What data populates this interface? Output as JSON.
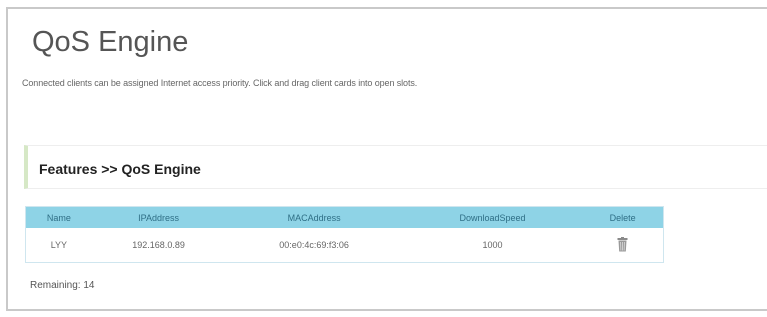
{
  "page": {
    "title": "QoS Engine",
    "description": "Connected clients can be assigned Internet access priority. Click and drag client cards into open slots."
  },
  "section": {
    "title": "Features >> QoS Engine"
  },
  "table": {
    "headers": [
      "Name",
      "IPAddress",
      "MACAddress",
      "DownloadSpeed",
      "Delete"
    ],
    "rows": [
      {
        "name": "LYY",
        "ip": "192.168.0.89",
        "mac": "00:e0:4c:69:f3:06",
        "speed": "1000",
        "delete_icon": "trash-icon"
      }
    ]
  },
  "remaining": "Remaining: 14",
  "colors": {
    "header_bg": "#8ed3e6",
    "header_text": "#2f6f86",
    "section_accent": "#d6e8c6"
  }
}
